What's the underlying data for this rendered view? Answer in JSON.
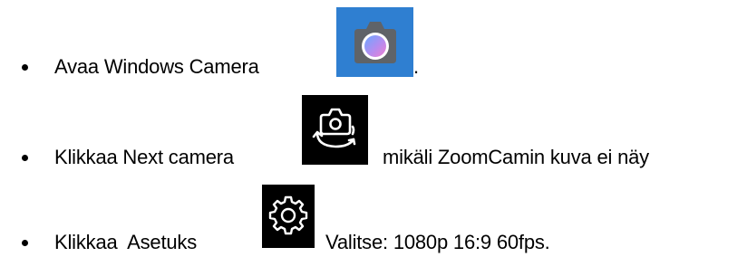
{
  "colors": {
    "text": "#000000",
    "camera_icon_bg": "#2f7fd1",
    "dark_icon_bg": "#000000"
  },
  "items": [
    {
      "text_before": "Avaa Windows Camera",
      "icon": "windows-camera-app-icon",
      "text_after": "."
    },
    {
      "text_before": "Klikkaa Next camera",
      "icon": "switch-camera-icon",
      "text_after": "mikäli ZoomCamin kuva ei näy"
    },
    {
      "text_before": "Klikkaa  Asetuks",
      "icon": "settings-gear-icon",
      "text_after": "Valitse: 1080p 16:9 60fps."
    }
  ]
}
